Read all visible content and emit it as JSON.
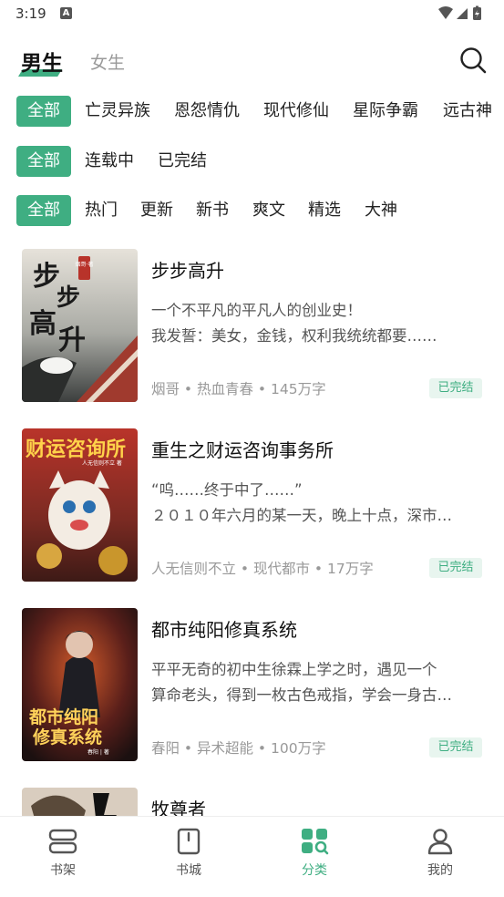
{
  "status": {
    "time": "3:19",
    "a_icon": "A"
  },
  "header": {
    "tab_male": "男生",
    "tab_female": "女生"
  },
  "filters": {
    "genre": [
      "全部",
      "亡灵异族",
      "恩怨情仇",
      "现代修仙",
      "星际争霸",
      "远古神"
    ],
    "status": [
      "全部",
      "连载中",
      "已完结"
    ],
    "sort": [
      "全部",
      "热门",
      "更新",
      "新书",
      "爽文",
      "精选",
      "大神"
    ]
  },
  "books": [
    {
      "title": "步步高升",
      "desc1": "一个不平凡的平凡人的创业史！",
      "desc2": "我发誓：美女，金钱，权利我统统都要……",
      "meta": "烟哥 • 热血青春 • 145万字",
      "badge": "已完结",
      "cover_text": "步步高升",
      "cover_seal": "烟哥·著"
    },
    {
      "title": "重生之财运咨询事务所",
      "desc1": "“呜……终于中了……”",
      "desc2": "２０１０年六月的某一天，晚上十点，深市…",
      "meta": "人无信则不立 • 现代都市 • 17万字",
      "badge": "已完结",
      "cover_text": "财运咨询所",
      "cover_sub": "人无信则不立 著"
    },
    {
      "title": "都市纯阳修真系统",
      "desc1": "平平无奇的初中生徐霖上学之时，遇见一个",
      "desc2": "算命老头，得到一枚古色戒指，学会一身古…",
      "meta": "春阳 • 异术超能 • 100万字",
      "badge": "已完结",
      "cover_text1": "都市纯阳",
      "cover_text2": "修真系统",
      "cover_sub": "春阳 | 著"
    },
    {
      "title": "牧尊者"
    }
  ],
  "nav": [
    {
      "label": "书架",
      "icon": "bookshelf-icon"
    },
    {
      "label": "书城",
      "icon": "bookstore-icon"
    },
    {
      "label": "分类",
      "icon": "category-icon"
    },
    {
      "label": "我的",
      "icon": "profile-icon"
    }
  ],
  "colors": {
    "accent": "#3fae82",
    "badge_bg": "#e8f5ef"
  }
}
